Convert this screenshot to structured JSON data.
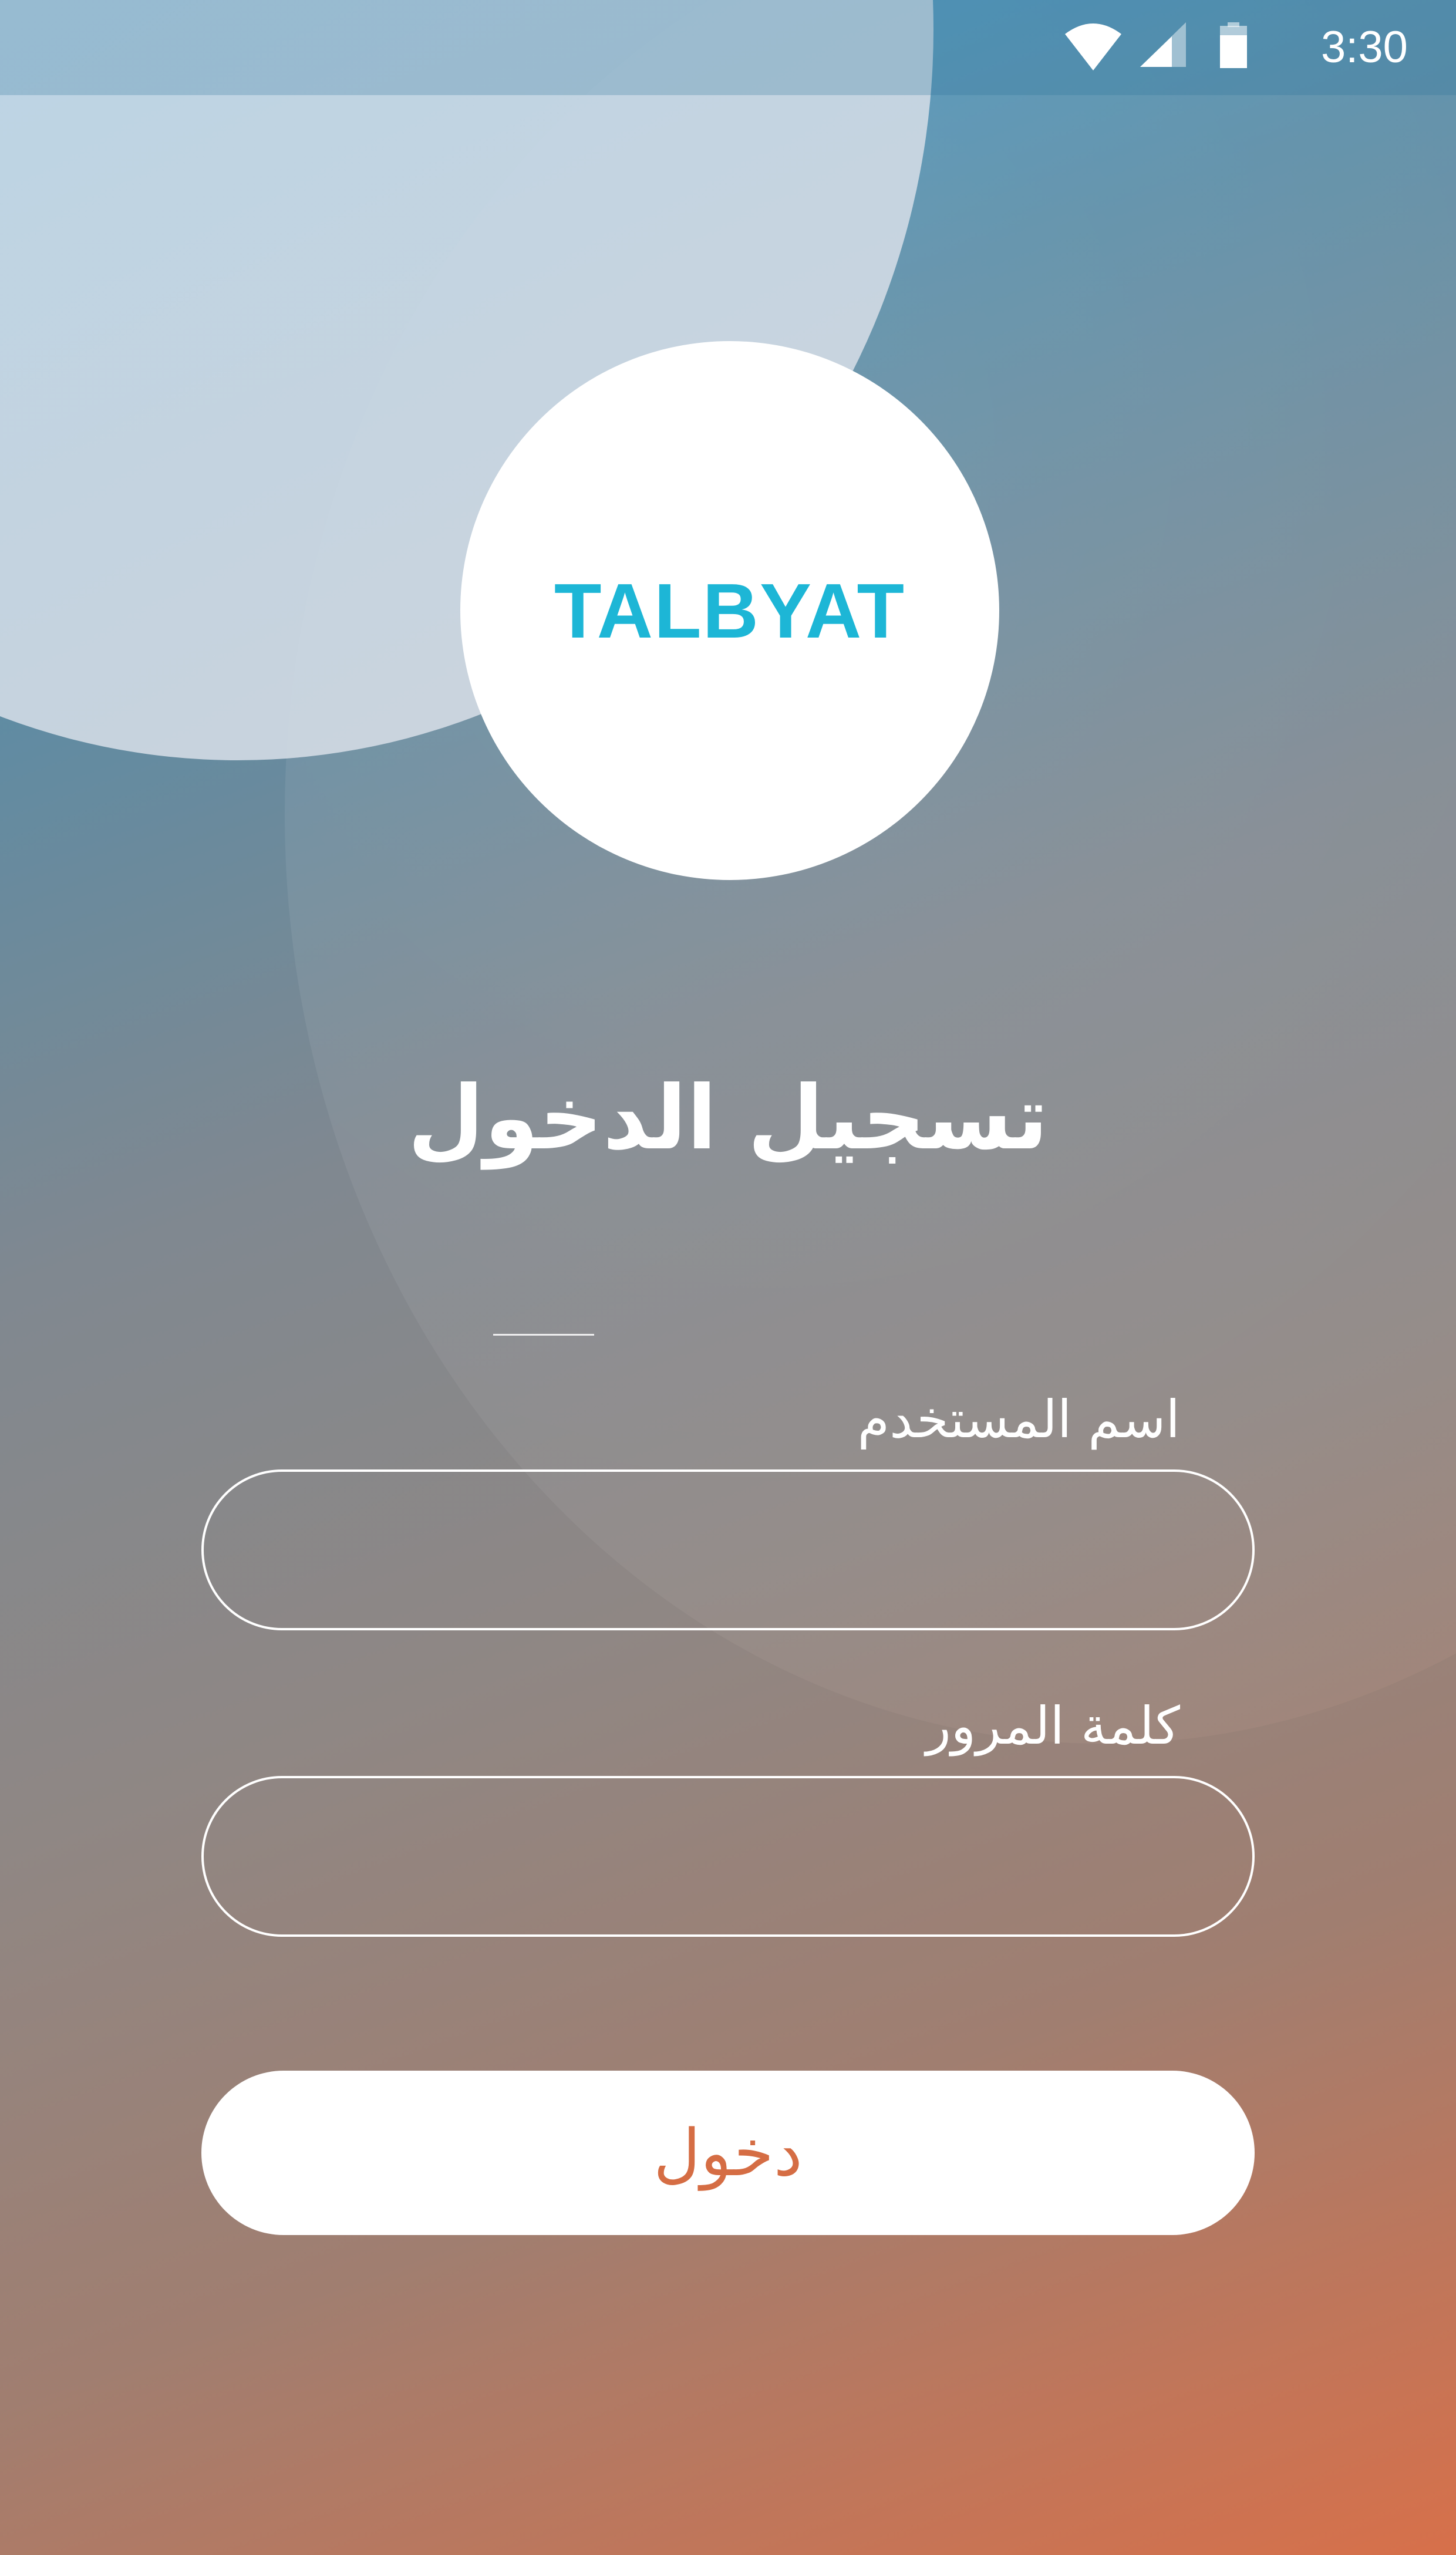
{
  "status_bar": {
    "time": "3:30",
    "icons": [
      "wifi-icon",
      "signal-icon",
      "battery-icon"
    ]
  },
  "logo": {
    "text": "TALBYAT",
    "color": "#1db6d6"
  },
  "login_form": {
    "title": "تسجيل الدخول",
    "username_label": "اسم المستخدم",
    "username_value": "",
    "password_label": "كلمة المرور",
    "password_value": "",
    "submit_label": "دخول"
  },
  "colors": {
    "accent": "#d56d44",
    "gradient_top": "#3e9bcc",
    "gradient_bottom": "#d7704a",
    "text": "#ffffff"
  }
}
